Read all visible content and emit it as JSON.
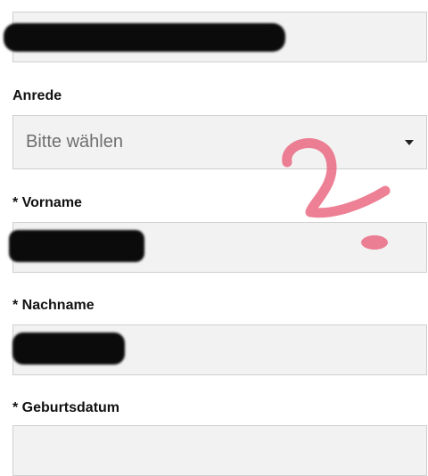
{
  "form": {
    "top_field": {
      "value": ""
    },
    "anrede": {
      "label": "Anrede",
      "placeholder": "Bitte wählen",
      "caret_icon": "chevron-down-icon"
    },
    "vorname": {
      "label": "* Vorname",
      "value": ""
    },
    "nachname": {
      "label": "* Nachname",
      "value": ""
    },
    "geburtsdatum": {
      "label": "* Geburtsdatum",
      "value": ""
    }
  },
  "annotation": {
    "shape": "question-mark",
    "color": "#e8607a"
  },
  "colors": {
    "field_background": "#f2f2f2",
    "field_border": "#cfcfcf",
    "placeholder_text": "#6f6f6f",
    "redaction": "#0b0b0b"
  }
}
